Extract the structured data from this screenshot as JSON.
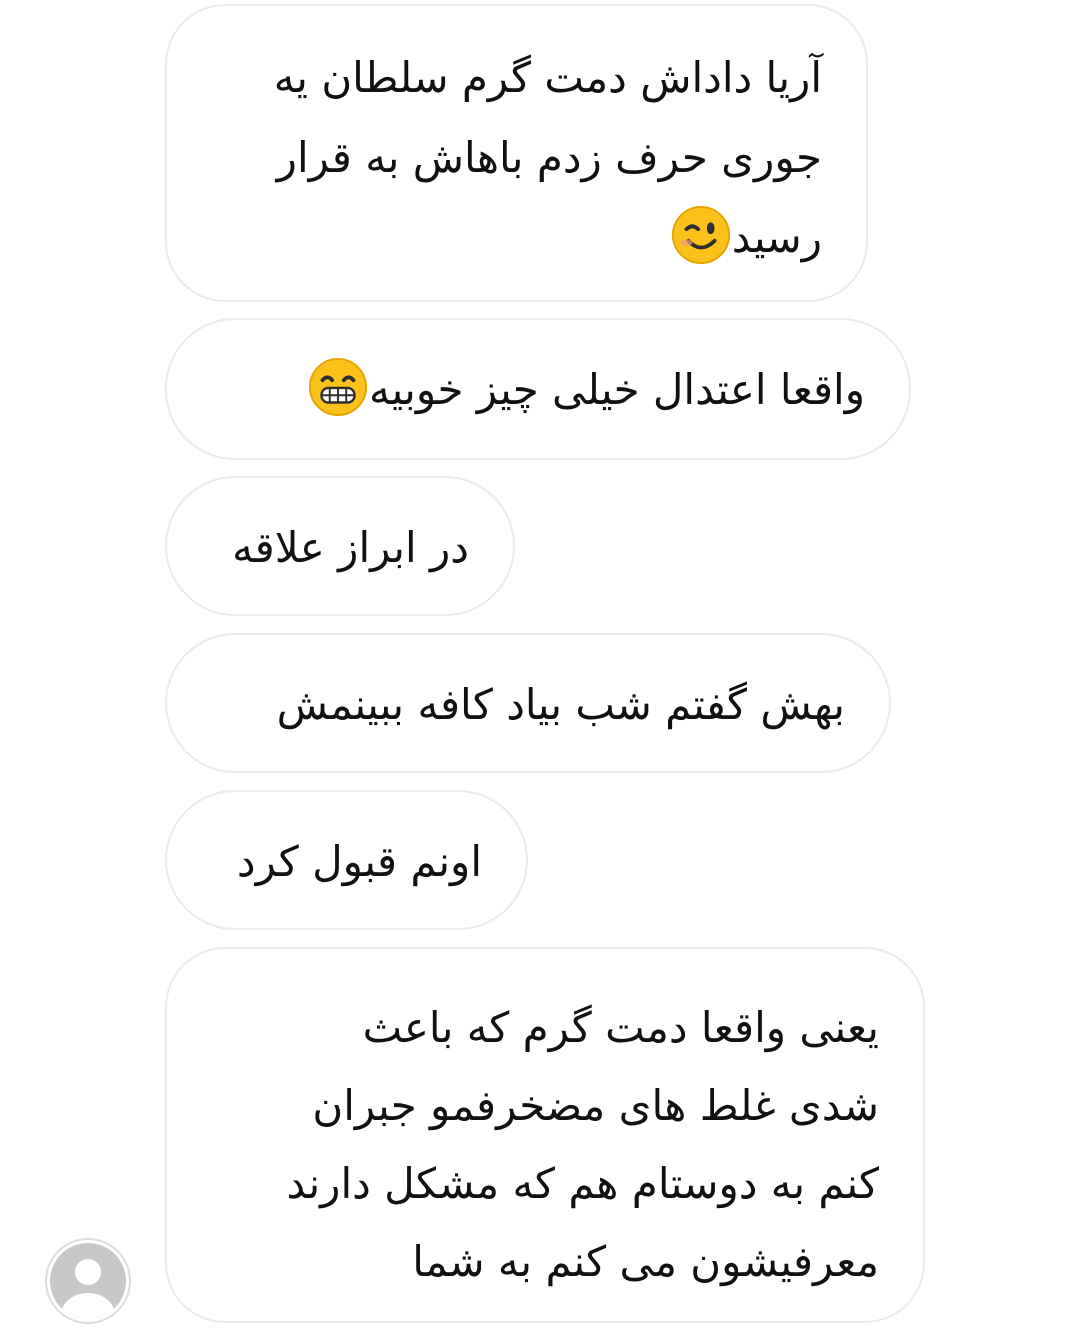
{
  "messages": [
    {
      "lines": [
        "آریا داداش دمت گرم سلطان یه",
        "جوری حرف زدم باهاش به قرار",
        "رسید"
      ],
      "emoji": "winking-face"
    },
    {
      "lines": [
        "واقعا اعتدال خیلی چیز خوبیه"
      ],
      "emoji": "grinning-face"
    },
    {
      "lines": [
        "در ابراز علاقه"
      ]
    },
    {
      "lines": [
        "بهش گفتم شب بیاد کافه ببینمش"
      ]
    },
    {
      "lines": [
        "اونم قبول کرد"
      ]
    },
    {
      "lines": [
        "یعنی واقعا دمت گرم که باعث",
        "شدی غلط های مضخرفمو جبران",
        "کنم به دوستام هم که مشکل دارند",
        "معرفیشون می کنم به شما"
      ]
    }
  ],
  "sender_avatar": {
    "icon": "default-user-avatar-icon"
  },
  "colors": {
    "bubble_border": "#ebebeb",
    "text": "#111111",
    "emoji_yellow": "#fcc21b",
    "avatar_gray": "#c7c7c7"
  }
}
